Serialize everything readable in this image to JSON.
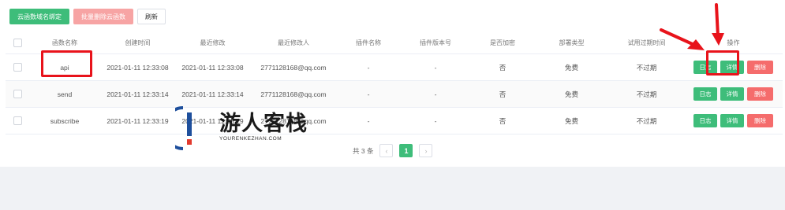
{
  "toolbar": {
    "cloud_btn": "云函数域名绑定",
    "batch_delete_btn": "批量删除云函数",
    "refresh_btn": "刷新"
  },
  "table": {
    "headers": [
      "函数名称",
      "创建时间",
      "最近修改",
      "最近修改人",
      "插件名称",
      "插件版本号",
      "是否加密",
      "部署类型",
      "试用过期时间",
      "操作"
    ],
    "rows": [
      {
        "name": "api",
        "created": "2021-01-11 12:33:08",
        "modified": "2021-01-11 12:33:08",
        "modifier": "2771128168@qq.com",
        "plugin": "-",
        "version": "-",
        "encrypted": "否",
        "type": "免费",
        "expire": "不过期"
      },
      {
        "name": "send",
        "created": "2021-01-11 12:33:14",
        "modified": "2021-01-11 12:33:14",
        "modifier": "2771128168@qq.com",
        "plugin": "-",
        "version": "-",
        "encrypted": "否",
        "type": "免费",
        "expire": "不过期"
      },
      {
        "name": "subscribe",
        "created": "2021-01-11 12:33:19",
        "modified": "2021-01-11 12:33:19",
        "modifier": "2771128168@qq.com",
        "plugin": "-",
        "version": "-",
        "encrypted": "否",
        "type": "免费",
        "expire": "不过期"
      }
    ],
    "actions": {
      "log": "日志",
      "detail": "详情",
      "delete": "删除"
    }
  },
  "pagination": {
    "total": "共 3 条",
    "current": "1",
    "prev": "‹",
    "next": "›"
  },
  "watermark": {
    "title": "游人客栈",
    "url": "YOURENKEZHAN.COM"
  },
  "colors": {
    "accent": "#3ebd7a",
    "danger": "#f56c6c",
    "annotation": "#e8131b"
  }
}
